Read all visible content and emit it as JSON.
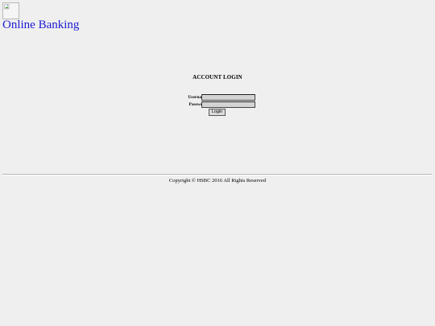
{
  "header": {
    "logo_icon": "broken-image-icon",
    "title": "Online Banking"
  },
  "login": {
    "heading": "ACCOUNT LOGIN",
    "username_label": "Username:",
    "username_value": "",
    "password_label": "Password:",
    "password_value": "",
    "button_label": "Login"
  },
  "footer": {
    "copyright": "Copyright © HSBC 2016 All Rights Reserved"
  },
  "colors": {
    "page_background": "#efefef",
    "title_link": "#1a1ad6",
    "input_background": "#d4d4d4"
  }
}
